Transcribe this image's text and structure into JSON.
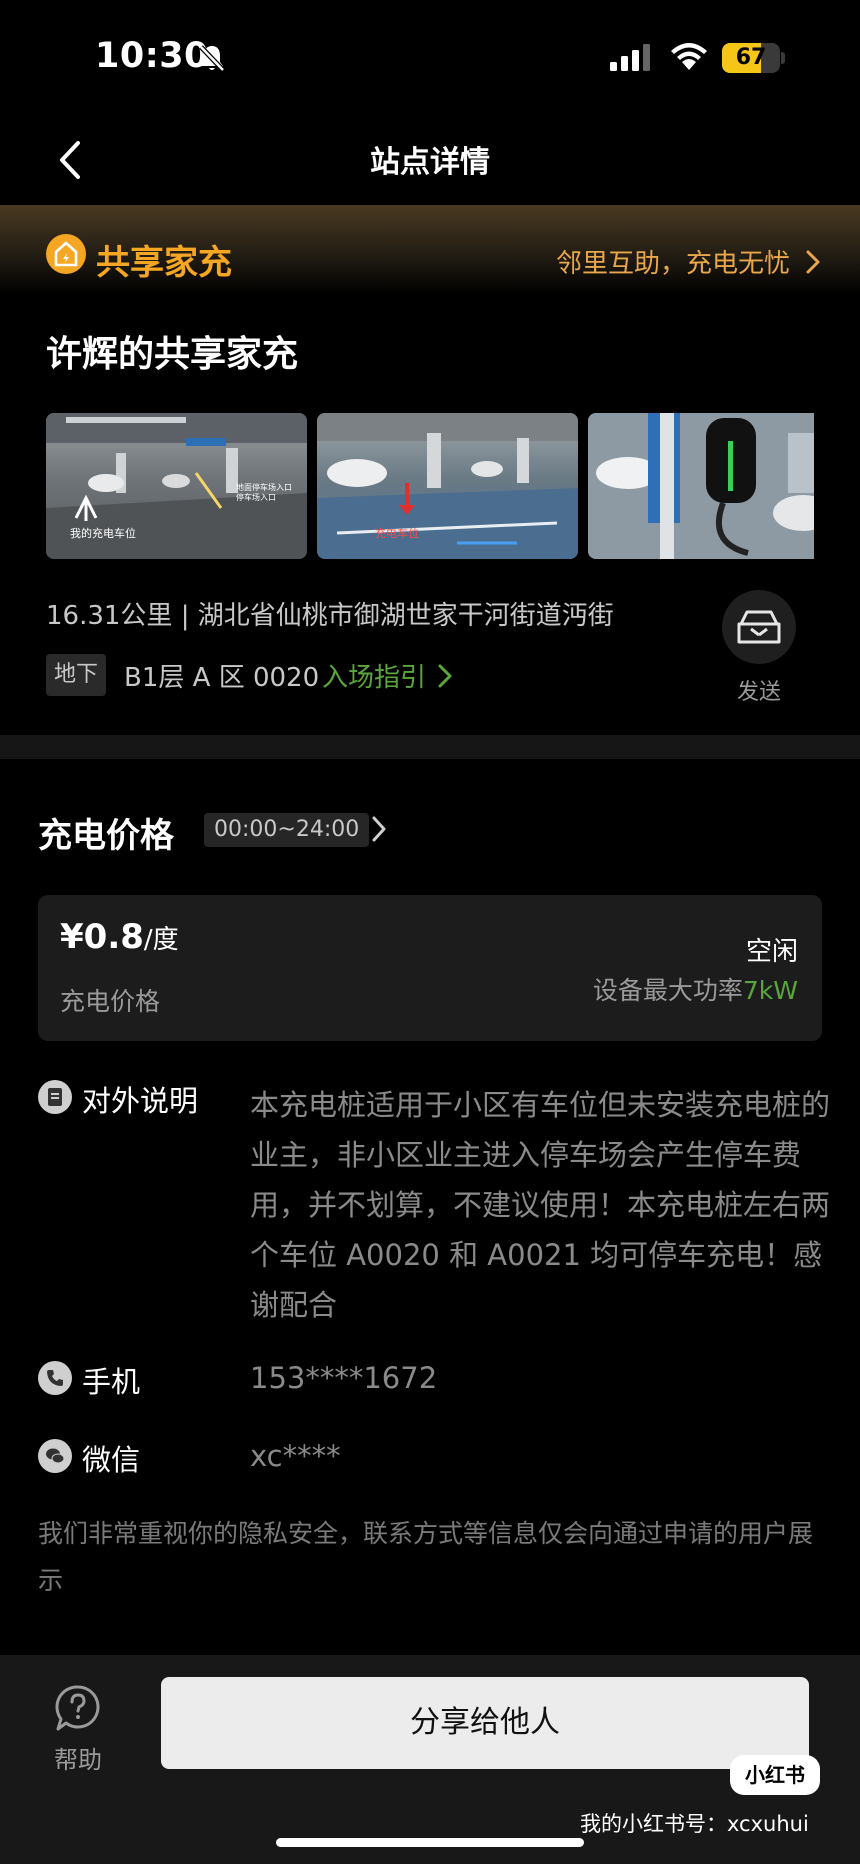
{
  "status_bar": {
    "time": "10:30",
    "battery_percent": "67",
    "battery_level": 0.67,
    "icons": [
      "bell-slash-icon",
      "signal-icon",
      "wifi-icon",
      "battery-icon"
    ]
  },
  "nav": {
    "title": "站点详情",
    "back_icon": "chevron-left-icon"
  },
  "banner": {
    "title": "共享家充",
    "link_text": "邻里互助，充电无忧",
    "accent": "#f5a623"
  },
  "station": {
    "name": "许辉的共享家充",
    "photos": [
      {
        "caption_1": "我的充电车位",
        "caption_2": "地面停车场入口 停车场入口"
      },
      {
        "caption_1": "充电车位",
        "caption_2": ""
      },
      {
        "caption_1": "",
        "caption_2": ""
      }
    ],
    "address": "16.31公里 | 湖北省仙桃市御湖世家干河街道沔街",
    "floor_tag": "地下",
    "spot": "B1层 A 区 0020",
    "guide_link": "入场指引",
    "send_label": "发送"
  },
  "price": {
    "heading": "充电价格",
    "time_range": "00:00~24:00",
    "value": "¥0.8",
    "unit": "/度",
    "label": "充电价格",
    "status": "空闲",
    "power_label": "设备最大功率",
    "power_value": "7kW",
    "power_color": "#5aa63c"
  },
  "info": {
    "description_label": "对外说明",
    "description": "本充电桩适用于小区有车位但未安装充电桩的业主，非小区业主进入停车场会产生停车费用，并不划算，不建议使用！本充电桩左右两个车位 A0020 和 A0021 均可停车充电！感谢配合",
    "phone_label": "手机",
    "phone": "153****1672",
    "wechat_label": "微信",
    "wechat": "xc****"
  },
  "privacy_note": "我们非常重视你的隐私安全，联系方式等信息仅会向通过申请的用户展示",
  "bottom": {
    "help_label": "帮助",
    "share_label": "分享给他人"
  },
  "watermark": {
    "logo": "小红书",
    "text": "我的小红书号：xcxuhui"
  }
}
